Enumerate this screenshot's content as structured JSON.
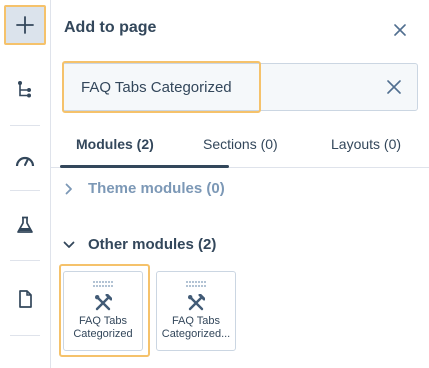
{
  "sidebar": {
    "items": [
      {
        "icon": "plus-icon",
        "active": true
      },
      {
        "icon": "tree-structure-icon",
        "active": false
      },
      {
        "icon": "speedometer-icon",
        "active": false
      },
      {
        "icon": "flask-icon",
        "active": false
      },
      {
        "icon": "document-icon",
        "active": false
      }
    ]
  },
  "panel": {
    "title": "Add to page",
    "close_icon": "close-icon"
  },
  "search": {
    "value": "FAQ Tabs Categorized",
    "clear_icon": "clear-icon"
  },
  "tabs": [
    {
      "label": "Modules (2)",
      "selected": true
    },
    {
      "label": "Sections (0)",
      "selected": false
    },
    {
      "label": "Layouts (0)",
      "selected": false
    }
  ],
  "groups": [
    {
      "label": "Theme modules (0)",
      "expanded": false
    },
    {
      "label": "Other modules (2)",
      "expanded": true
    }
  ],
  "modules": [
    {
      "line1": "FAQ Tabs",
      "line2": "Categorized"
    },
    {
      "line1": "FAQ Tabs",
      "line2": "Categorized..."
    }
  ],
  "colors": {
    "text": "#33475b",
    "muted": "#7c98b6",
    "highlight": "#f5c26b",
    "border": "#cbd6e2"
  }
}
